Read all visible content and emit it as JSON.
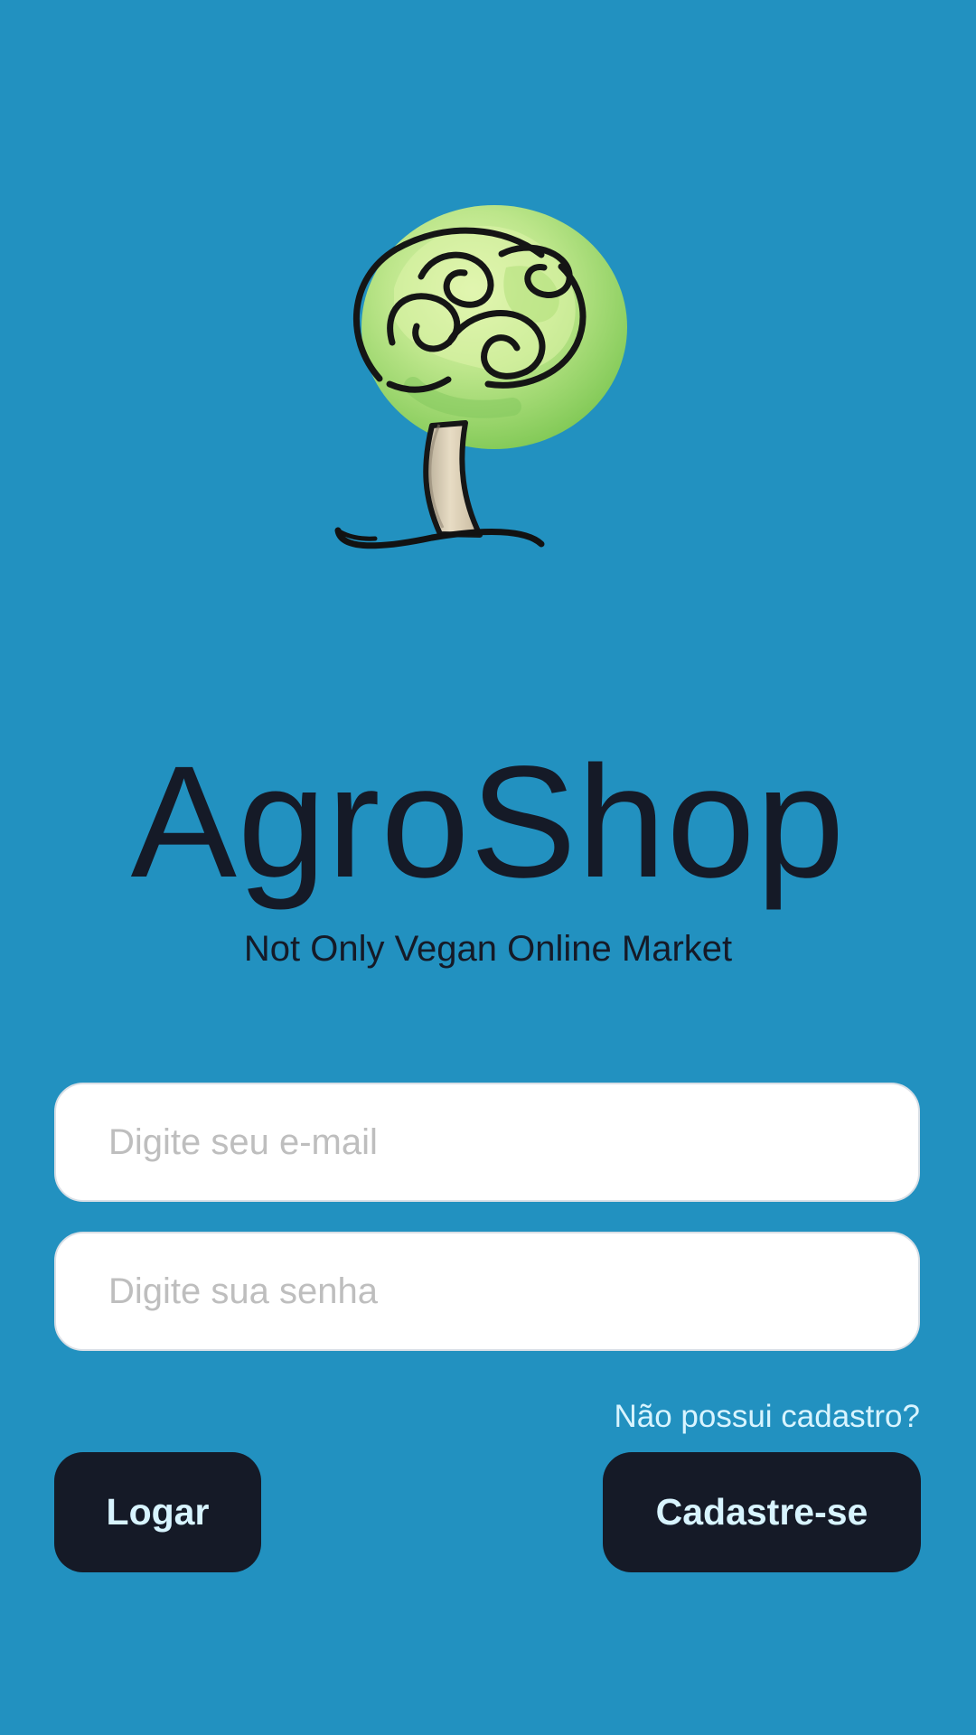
{
  "app": {
    "title": "AgroShop",
    "subtitle": "Not Only Vegan Online Market",
    "logo_icon": "tree-logo-icon"
  },
  "login_form": {
    "email": {
      "value": "",
      "placeholder": "Digite seu e-mail"
    },
    "password": {
      "value": "",
      "placeholder": "Digite sua senha"
    },
    "register_prompt": "Não possui cadastro?",
    "login_button_label": "Logar",
    "register_button_label": "Cadastre-se"
  },
  "colors": {
    "background": "#2291c0",
    "primary_text": "#151a27",
    "button_background": "#151a27",
    "button_text": "#d8f4ff",
    "input_background": "#ffffff",
    "placeholder": "#bebebe"
  }
}
